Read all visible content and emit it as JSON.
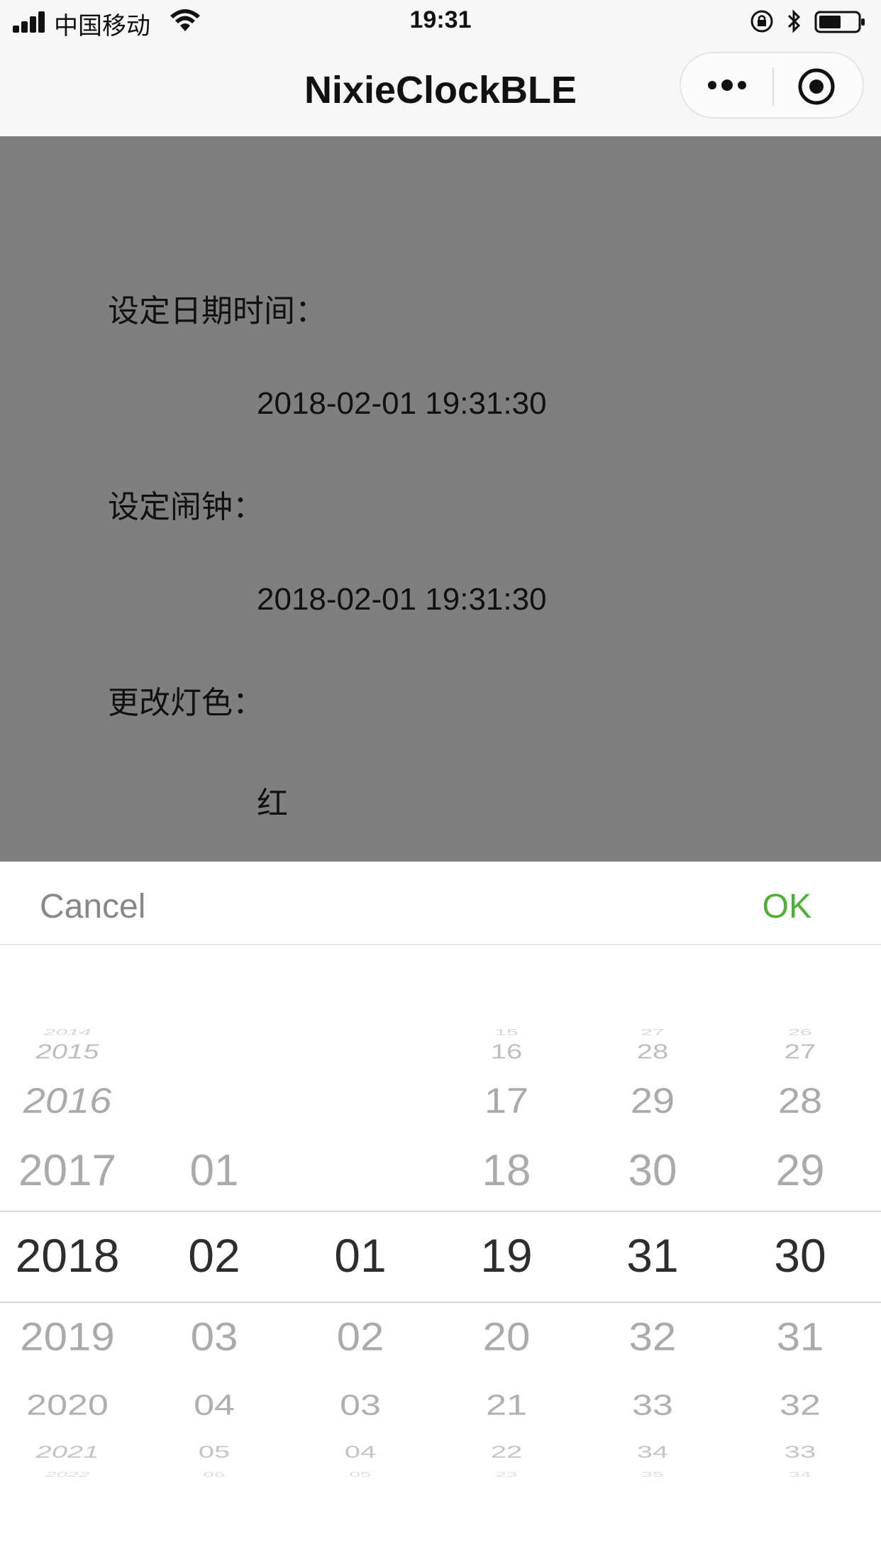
{
  "status_bar": {
    "carrier": "中国移动",
    "time": "19:31"
  },
  "nav": {
    "title": "NixieClockBLE"
  },
  "content": {
    "datetime_label": "设定日期时间：",
    "datetime_value": "2018-02-01 19:31:30",
    "alarm_label": "设定闹钟：",
    "alarm_value": "2018-02-01 19:31:30",
    "color_label": "更改灯色：",
    "color_value": "红"
  },
  "picker": {
    "cancel_label": "Cancel",
    "ok_label": "OK",
    "columns": [
      {
        "name": "year",
        "m3": "2014",
        "m2": "2015",
        "m1": "2016",
        "m0": "2017",
        "selected": "2018",
        "p1": "2019",
        "p2": "2020",
        "p3": "2021",
        "p4": "2022"
      },
      {
        "name": "month",
        "m3": "",
        "m2": "",
        "m1": "",
        "m0": "01",
        "selected": "02",
        "p1": "03",
        "p2": "04",
        "p3": "05",
        "p4": "06"
      },
      {
        "name": "day",
        "m3": "",
        "m2": "",
        "m1": "",
        "m0": "",
        "selected": "01",
        "p1": "02",
        "p2": "03",
        "p3": "04",
        "p4": "05"
      },
      {
        "name": "hour",
        "m3": "15",
        "m2": "16",
        "m1": "17",
        "m0": "18",
        "selected": "19",
        "p1": "20",
        "p2": "21",
        "p3": "22",
        "p4": "23"
      },
      {
        "name": "minute",
        "m3": "27",
        "m2": "28",
        "m1": "29",
        "m0": "30",
        "selected": "31",
        "p1": "32",
        "p2": "33",
        "p3": "34",
        "p4": "35"
      },
      {
        "name": "second",
        "m3": "26",
        "m2": "27",
        "m1": "28",
        "m0": "29",
        "selected": "30",
        "p1": "31",
        "p2": "32",
        "p3": "33",
        "p4": "34"
      }
    ]
  },
  "colors": {
    "ok_green": "#4fb035",
    "overlay_gray": "#7f7f7f",
    "cancel_gray": "#888888"
  }
}
